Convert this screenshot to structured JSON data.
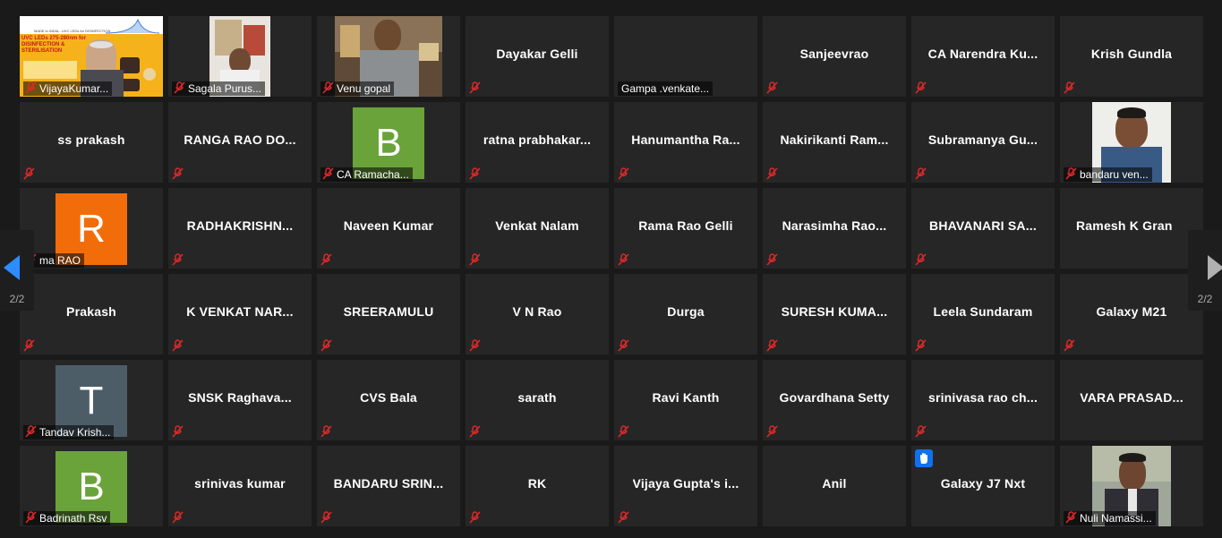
{
  "navigation": {
    "prev_page": "2/2",
    "next_page": "2/2",
    "prev_arrow_color": "#2d8cff",
    "next_arrow_color": "#b0b0b0"
  },
  "colors": {
    "tile_bg": "#262626",
    "page_bg": "#1a1a1a",
    "mute_red": "#e02828",
    "avatar_green": "#6aa33a",
    "avatar_orange": "#f26d0a",
    "avatar_slate": "#4d5d68",
    "raise_hand_blue": "#0e72ed"
  },
  "row1": {
    "t1": "VijayaKumar...",
    "t1_slide_title": "MADE in INDIA - UVC LEDs for DISINFECTION",
    "t1_slide_heading": "UVC LEDs 275-280nm for DISINFECTION & STERILISATION",
    "t2": "Sagala Purus...",
    "t3": "Venu gopal",
    "t4": "Dayakar Gelli",
    "t5": "Gampa .venkate...",
    "t6": "Sanjeevrao",
    "t7": "CA Narendra Ku...",
    "t8": "Krish Gundla"
  },
  "row2": {
    "t1": "ss prakash",
    "t2": "RANGA RAO DO...",
    "t3_letter": "B",
    "t3": "CA Ramacha...",
    "t4": "ratna  prabhakar...",
    "t5": "Hanumantha  Ra...",
    "t6": "Nakirikanti  Ram...",
    "t7": "Subramanya  Gu...",
    "t8": "bandaru ven..."
  },
  "row3": {
    "t1_letter": "R",
    "t1": "ma RAO",
    "t2": "RADHAKRISHN...",
    "t3": "Naveen Kumar",
    "t4": "Venkat Nalam",
    "t5": "Rama Rao Gelli",
    "t6": "Narasimha  Rao...",
    "t7": "BHAVANARI SA...",
    "t8": "Ramesh K Gran"
  },
  "row4": {
    "t1": "Prakash",
    "t2": "K VENKAT NAR...",
    "t3": "SREERAMULU",
    "t4": "V N Rao",
    "t5": "Durga",
    "t6": "SURESH  KUMA...",
    "t7": "Leela Sundaram",
    "t8": "Galaxy M21"
  },
  "row5": {
    "t1_letter": "T",
    "t1": "Tandav Krish...",
    "t2": "SNSK  Raghava...",
    "t3": "CVS Bala",
    "t4": "sarath",
    "t5": "Ravi Kanth",
    "t6": "Govardhana Setty",
    "t7": "srinivasa  rao  ch...",
    "t8": "VARA PRASAD..."
  },
  "row6": {
    "t1_letter": "B",
    "t1": "Badrinath Rsv",
    "t2": "srinivas kumar",
    "t3": "BANDARU  SRIN...",
    "t4": "RK",
    "t5": "Vijaya  Gupta's  i...",
    "t6": "Anil",
    "t7": "Galaxy J7 Nxt",
    "t8": "Nuli Namassi..."
  }
}
